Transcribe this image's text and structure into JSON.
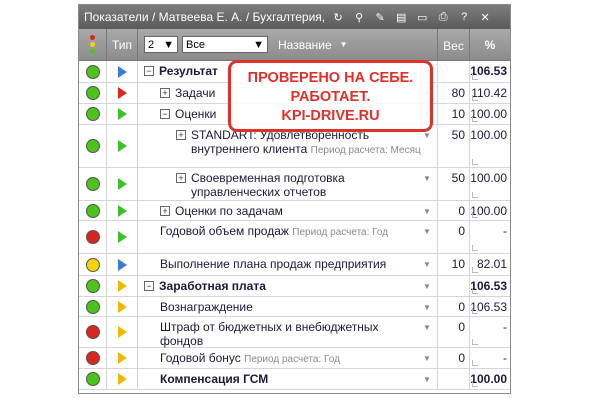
{
  "window": {
    "title": "Показатели / Матвеева Е. А. / Бухгалтерия, "
  },
  "header": {
    "col_type": "Тип",
    "level_value": "2",
    "filter_value": "Все",
    "col_name": "Название",
    "col_weight": "Вес",
    "col_percent": "%"
  },
  "stamp": {
    "line1": "ПРОВЕРЕНО НА СЕБЕ.",
    "line2": "РАБОТАЕТ.",
    "line3": "KPI-DRIVE.RU"
  },
  "colors": {
    "green": "#4cc31a",
    "red": "#d8261e",
    "yellow": "#f4d20c",
    "blue": "#3a7bd5",
    "tri_green": "#3cbf2a",
    "tri_red": "#d8261e",
    "tri_yellow": "#f0b800"
  },
  "rows": [
    {
      "status": "green",
      "type": "blue",
      "indent": 0,
      "expander": "⊟",
      "name": "Результат",
      "period": "",
      "weight": "",
      "percent": "106.53",
      "bold": true,
      "h": 22
    },
    {
      "status": "green",
      "type": "red",
      "indent": 1,
      "expander": "⊞",
      "name": "Задачи",
      "period": "",
      "weight": "80",
      "percent": "110.42",
      "bold": false,
      "h": 21
    },
    {
      "status": "green",
      "type": "green",
      "indent": 1,
      "expander": "⊟",
      "name": "Оценки",
      "period": "",
      "weight": "10",
      "percent": "100.00",
      "bold": false,
      "h": 21
    },
    {
      "status": "green",
      "type": "green",
      "indent": 2,
      "expander": "⊞",
      "name": "STANDART: Удовлетворенность внутреннего клиента",
      "period": "Период расчета: Месяц",
      "weight": "50",
      "percent": "100.00",
      "bold": false,
      "h": 43
    },
    {
      "status": "green",
      "type": "green",
      "indent": 2,
      "expander": "⊞",
      "name": "Своевременная подготовка управленческих отчетов",
      "period": "",
      "weight": "50",
      "percent": "100.00",
      "bold": false,
      "h": 33
    },
    {
      "status": "green",
      "type": "green",
      "indent": 1,
      "expander": "⊞",
      "name": "Оценки по задачам",
      "period": "",
      "weight": "0",
      "percent": "100.00",
      "bold": false,
      "h": 20
    },
    {
      "status": "red",
      "type": "green",
      "indent": 1,
      "expander": "",
      "name": "Годовой объем продаж",
      "period": "Период расчета: Год",
      "weight": "0",
      "percent": "-",
      "bold": false,
      "h": 33
    },
    {
      "status": "yellow",
      "type": "blue",
      "indent": 1,
      "expander": "",
      "name": "Выполнение плана продаж предприятия",
      "period": "",
      "weight": "10",
      "percent": "82.01",
      "bold": false,
      "h": 22
    },
    {
      "status": "green",
      "type": "yellow",
      "indent": 0,
      "expander": "⊟",
      "name": "Заработная плата",
      "period": "",
      "weight": "",
      "percent": "106.53",
      "bold": true,
      "h": 21
    },
    {
      "status": "green",
      "type": "yellow",
      "indent": 1,
      "expander": "",
      "name": "Вознаграждение",
      "period": "",
      "weight": "0",
      "percent": "106.53",
      "bold": false,
      "h": 20
    },
    {
      "status": "red",
      "type": "yellow",
      "indent": 1,
      "expander": "",
      "name": "Штраф от бюджетных и внебюджетных фондов",
      "period": "",
      "weight": "0",
      "percent": "-",
      "bold": false,
      "h": 31
    },
    {
      "status": "red",
      "type": "yellow",
      "indent": 1,
      "expander": "",
      "name": "Годовой бонус",
      "period": "Период расчета: Год",
      "weight": "0",
      "percent": "-",
      "bold": false,
      "h": 21
    },
    {
      "status": "green",
      "type": "yellow",
      "indent": 1,
      "expander": "",
      "name": "Компенсация ГСМ",
      "period": "",
      "weight": "",
      "percent": "100.00",
      "bold": true,
      "h": 21
    }
  ]
}
